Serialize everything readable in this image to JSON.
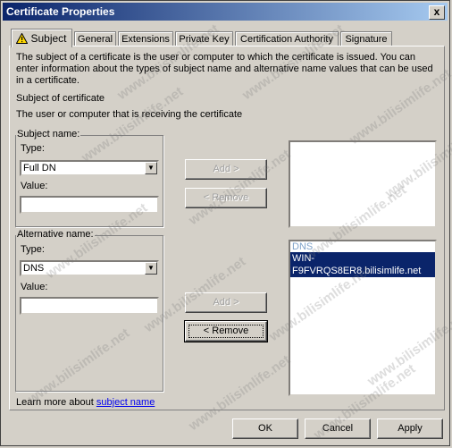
{
  "window": {
    "title": "Certificate Properties",
    "close_glyph": "x"
  },
  "tabs": [
    {
      "label": "Subject",
      "active": true
    },
    {
      "label": "General"
    },
    {
      "label": "Extensions"
    },
    {
      "label": "Private Key"
    },
    {
      "label": "Certification Authority"
    },
    {
      "label": "Signature"
    }
  ],
  "intro": {
    "line1": "The subject of a certificate is the user or computer to which the certificate is issued. You can",
    "line2": "enter information about the types of subject name and alternative name values that can be used",
    "line3": "in a certificate."
  },
  "section": {
    "heading": "Subject of certificate",
    "description": "The user or computer that is receiving the certificate"
  },
  "subject_name": {
    "group_label": "Subject name:",
    "type_label": "Type:",
    "type_value": "Full DN",
    "value_label": "Value:",
    "value": "",
    "add_label": "Add >",
    "remove_label": "< Remove",
    "entries": []
  },
  "alternative_name": {
    "group_label": "Alternative name:",
    "type_label": "Type:",
    "type_value": "DNS",
    "value_label": "Value:",
    "value": "",
    "add_label": "Add >",
    "remove_label": "< Remove",
    "entries_header": "DNS",
    "selected_entry": "WIN-F9FVRQS8ER8.bilisimlife.net"
  },
  "learn_more": {
    "prefix": "Learn more about ",
    "link": "subject name"
  },
  "footer": {
    "ok": "OK",
    "cancel": "Cancel",
    "apply": "Apply"
  },
  "watermark": {
    "text": "www.bilisimlife.net",
    "color": "#787878"
  },
  "colors": {
    "selection": "#0a246a",
    "titlebar": "#0a246a",
    "face": "#d4d0c8",
    "link": "#0000ee"
  }
}
